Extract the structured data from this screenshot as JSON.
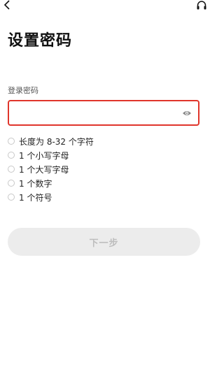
{
  "header": {
    "back_icon": "chevron-left-icon",
    "help_icon": "headset-icon"
  },
  "title": "设置密码",
  "password_field": {
    "label": "登录密码",
    "value": "",
    "placeholder": "",
    "toggle_icon": "eye-icon"
  },
  "rules": [
    {
      "label": "长度为 8-32 个字符",
      "checked": false
    },
    {
      "label": "1 个小写字母",
      "checked": false
    },
    {
      "label": "1 个大写字母",
      "checked": false
    },
    {
      "label": "1 个数字",
      "checked": false
    },
    {
      "label": "1 个符号",
      "checked": false
    }
  ],
  "next_button": {
    "label": "下一步",
    "enabled": false
  },
  "colors": {
    "accent_border": "#e0352b",
    "disabled_button_bg": "#ececec",
    "disabled_button_text": "#bdbdbd"
  }
}
